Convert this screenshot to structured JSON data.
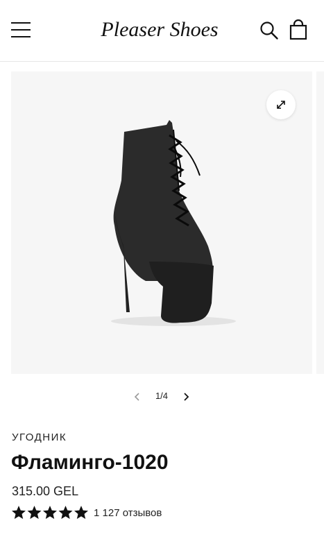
{
  "header": {
    "logo_text": "Pleaser Shoes",
    "icons": [
      "menu-icon",
      "search-icon",
      "cart-icon"
    ]
  },
  "gallery": {
    "zoom_icon": "expand-arrows-icon",
    "image_alt": "black lace-up platform ankle boot",
    "pager": {
      "current_of_total": "1/4"
    }
  },
  "product": {
    "vendor": "УГОДНИК",
    "title": "Фламинго-1020",
    "price": "315.00 GEL",
    "rating": {
      "stars": 5,
      "reviews_label": "1 127 отзывов"
    }
  },
  "colors": {
    "text": "#111111",
    "gallery_bg": "#f6f6f6",
    "divider": "#e6e6e6"
  }
}
